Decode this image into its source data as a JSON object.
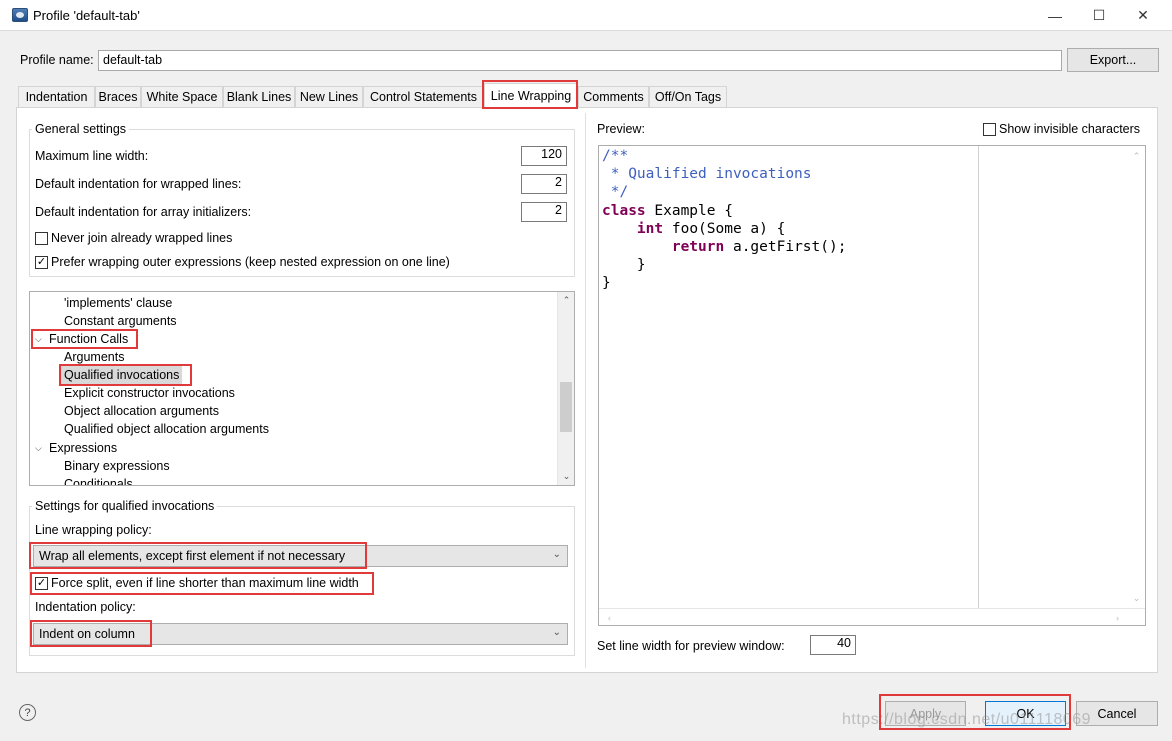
{
  "window": {
    "title": "Profile 'default-tab'",
    "minimize": "—",
    "maximize": "☐",
    "close": "✕"
  },
  "profile": {
    "label": "Profile name:",
    "value": "default-tab",
    "export_label": "Export..."
  },
  "tabs": [
    {
      "label": "Indentation"
    },
    {
      "label": "Braces"
    },
    {
      "label": "White Space"
    },
    {
      "label": "Blank Lines"
    },
    {
      "label": "New Lines"
    },
    {
      "label": "Control Statements"
    },
    {
      "label": "Line Wrapping"
    },
    {
      "label": "Comments"
    },
    {
      "label": "Off/On Tags"
    }
  ],
  "active_tab": "Line Wrapping",
  "general": {
    "title": "General settings",
    "max_width_label": "Maximum line width:",
    "max_width_value": "120",
    "wrapped_indent_label": "Default indentation for wrapped lines:",
    "wrapped_indent_value": "2",
    "array_indent_label": "Default indentation for array initializers:",
    "array_indent_value": "2",
    "never_join_label": "Never join already wrapped lines",
    "never_join_checked": false,
    "prefer_outer_label": "Prefer wrapping outer expressions (keep nested expression on one line)",
    "prefer_outer_checked": true,
    "check_mark": "✓"
  },
  "tree": {
    "items": [
      {
        "label": "'implements' clause"
      },
      {
        "label": "Constant arguments"
      },
      {
        "label": "Function Calls",
        "expanded": true
      },
      {
        "label": "Arguments"
      },
      {
        "label": "Qualified invocations",
        "selected": true
      },
      {
        "label": "Explicit constructor invocations"
      },
      {
        "label": "Object allocation arguments"
      },
      {
        "label": "Qualified object allocation arguments"
      },
      {
        "label": "Expressions",
        "expanded": true
      },
      {
        "label": "Binary expressions"
      },
      {
        "label": "Conditionals"
      }
    ],
    "chevron": "⌵",
    "up": "⌃",
    "down": "⌄"
  },
  "qualified": {
    "title": "Settings for qualified invocations",
    "policy_label": "Line wrapping policy:",
    "policy_value": "Wrap all elements, except first element if not necessary",
    "force_split_label": "Force split, even if line shorter than maximum line width",
    "force_split_checked": true,
    "indent_label": "Indentation policy:",
    "indent_value": "Indent on column"
  },
  "preview": {
    "label": "Preview:",
    "show_invisible_label": "Show invisible characters",
    "show_invisible_checked": false,
    "line_width_label": "Set line width for preview window:",
    "line_width_value": "40",
    "code": {
      "l1": "/**",
      "l2": " * Qualified invocations",
      "l3": " */",
      "kw_class": "class",
      "l4_rest": " Example {",
      "kw_int": "int",
      "l5_rest": " foo(Some a) {",
      "kw_return": "return",
      "l6_rest": " a.getFirst();",
      "l7": "    }",
      "l8": "}"
    }
  },
  "buttons": {
    "help": "?",
    "apply": "Apply",
    "ok": "OK",
    "cancel": "Cancel"
  },
  "watermark": "https://blog.csdn.net/u011118069",
  "colors": {
    "highlight": "#e03a3a",
    "comment": "#3f5fbf",
    "keyword": "#7f0055"
  }
}
